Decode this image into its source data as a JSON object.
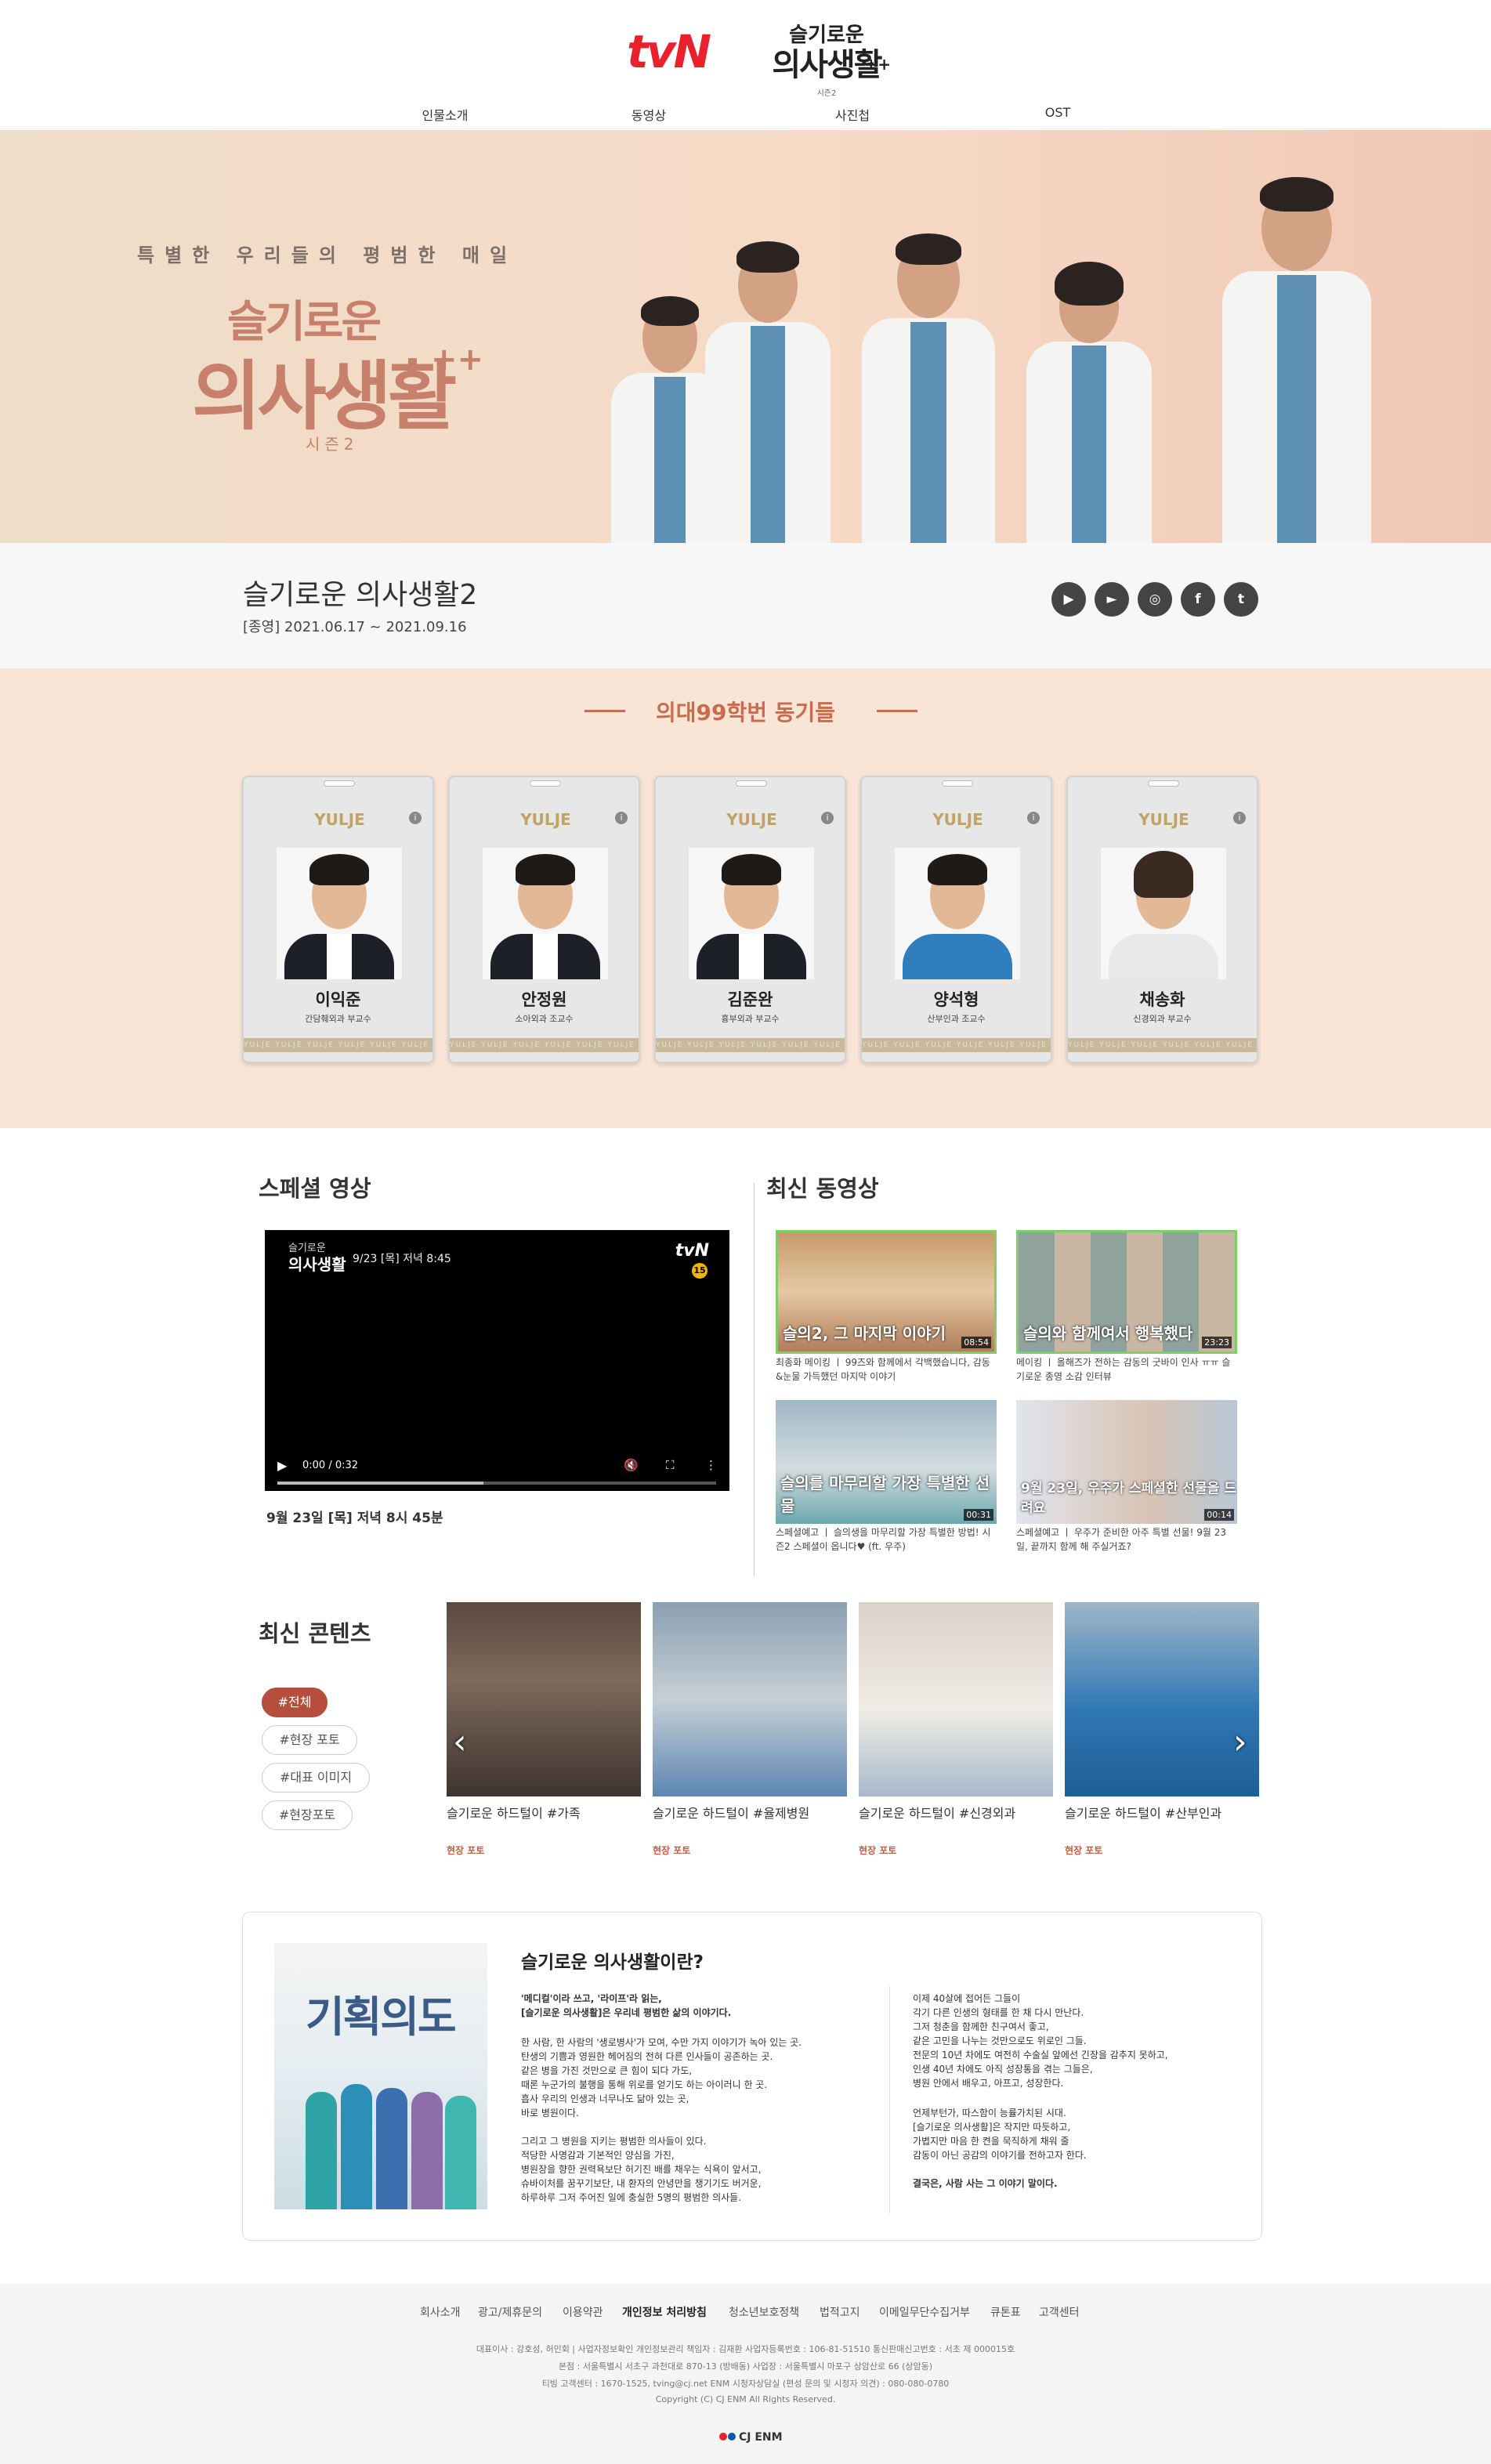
{
  "header": {
    "tvn_logo": "tvN",
    "show_logo_line1": "슬기로운",
    "show_logo_line2": "의사생활",
    "show_logo_plus": "++",
    "show_logo_season": "시즌2"
  },
  "nav": {
    "items": [
      "인물소개",
      "동영상",
      "사진첩",
      "OST"
    ]
  },
  "hero": {
    "tagline": "특별한 우리들의 평범한 매일",
    "title_line1": "슬기로운",
    "title_line2": "의사생활",
    "title_plus": "++",
    "season": "시즌2"
  },
  "info": {
    "title": "슬기로운 의사생활2",
    "date": "[종영] 2021.06.17 ~ 2021.09.16",
    "sns": [
      "tving-icon",
      "youtube-icon",
      "instagram-icon",
      "facebook-icon",
      "twitter-icon"
    ]
  },
  "cast": {
    "heading": "의대99학번 동기들",
    "hospital_logo": "YULJE",
    "band_text": "YULJE YULJE YULJE YULJE YULJE YULJE YULJE",
    "members": [
      {
        "name": "이익준",
        "role": "간담췌외과 부교수"
      },
      {
        "name": "안정원",
        "role": "소아외과 조교수"
      },
      {
        "name": "김준완",
        "role": "흉부외과 부교수"
      },
      {
        "name": "양석형",
        "role": "산부인과 조교수"
      },
      {
        "name": "채송화",
        "role": "신경외과 부교수"
      }
    ]
  },
  "special": {
    "heading": "스페셜 영상",
    "player_sub1": "슬기로운",
    "player_sub2": "의사생활",
    "player_sub3": "9/23 [목] 저녁 8:45",
    "player_channel": "tvN",
    "player_age": "15",
    "player_time": "0:00 / 0:32",
    "player_progress": 0.47,
    "air_text": "9월 23일 [목] 저녁 8시 45분"
  },
  "latest_videos": {
    "heading": "최신 동영상",
    "items": [
      {
        "overlay": "슬의2, 그 마지막 이야기",
        "duration": "08:54",
        "caption": "최종화 메이킹 ㅣ 99즈와 함께에서 각백했습니다, 감동&눈물 가득했던 마지막 이야기"
      },
      {
        "overlay": "슬의와 함께여서 행복했다",
        "duration": "23:23",
        "caption": "메이킹 ㅣ 올해즈가 전하는 감동의 굿바이 인사 ㅠㅠ 슬기로운 종영 소감 인터뷰"
      },
      {
        "overlay": "슬의를 마무리할 가장 특별한 선물",
        "duration": "00:31",
        "caption": "스페셜예고 ㅣ 슬의생을 마무리할 가장 특별한 방법! 시즌2 스페셜이 옵니다♥ (ft. 우주)"
      },
      {
        "overlay": "9월 23일, 우주가 스페셜한 선물을 드려요",
        "duration": "00:14",
        "caption": "스페셜예고 ㅣ 우주가 준비한 아주 특별 선물! 9월 23일, 끝까지 함께 해 주실거죠?"
      }
    ]
  },
  "contents": {
    "heading": "최신 콘텐츠",
    "filters": [
      "#전체",
      "#현장 포토",
      "#대표 이미지",
      "#현장포토"
    ],
    "active_filter": 0,
    "items": [
      {
        "title": "슬기로운 하드털이 #가족",
        "category": "현장 포토"
      },
      {
        "title": "슬기로운 하드털이 #율제병원",
        "category": "현장 포토"
      },
      {
        "title": "슬기로운 하드털이 #신경외과",
        "category": "현장 포토"
      },
      {
        "title": "슬기로운 하드털이 #산부인과",
        "category": "현장 포토"
      }
    ]
  },
  "about": {
    "poster_text": "기획의도",
    "heading": "슬기로운 의사생활이란?",
    "left_bold": "'메디컬'이라 쓰고, '라이프'라 읽는,\n[슬기로운 의사생활]은 우리네 평범한 삶의 이야기다.",
    "left_p1": "한 사람, 한 사람의 '생로병사'가 모여, 수만 가지 이야기가 녹아 있는 곳.\n탄생의 기쁨과 영원한 헤어짐의 전혀 다른 인사들이 공존하는 곳.\n같은 병을 가진 것만으로 큰 힘이 되다 가도,\n때론 누군가의 불행을 통해 위로를 얻기도 하는 아이러니 한 곳.\n흡사 우리의 인생과 너무나도 닮아 있는 곳,\n바로 병원이다.",
    "left_p2": "그리고 그 병원을 지키는 평범한 의사들이 있다.\n적당한 사명감과 기본적인 양심을 가진,\n병원장을 향한 권력욕보단 허기진 배를 채우는 식욕이 앞서고,\n슈바이처를 꿈꾸기보단, 내 환자의 안녕만을 챙기기도 버거운,\n하루하루 그저 주어진 일에 충실한 5명의 평범한 의사들.",
    "right_p1": "이제 40살에 접어든 그들이\n각기 다른 인생의 형태를 한 채 다시 만난다.\n그저 청춘을 함께한 친구여서 좋고,\n같은 고민을 나누는 것만으로도 위로인 그들.\n전문의 10년 차에도 여전히 수술실 앞에선 긴장을 감추지 못하고,\n인생 40년 차에도 아직 성장통을 겪는 그들은,\n병원 안에서 배우고, 아프고, 성장한다.",
    "right_p2": "언제부턴가, 따스함이 능률가치된 시대.\n[슬기로운 의사생활]은 작지만 따듯하고,\n가볍지만 마음 한 켠을 묵직하게 채워 줄\n감동이 아닌 공감의 이야기를 전하고자 한다.",
    "right_bold": "결국은, 사람 사는 그 이야기 말이다."
  },
  "footer": {
    "links": [
      "회사소개",
      "광고/제휴문의",
      "이용약관",
      "개인정보 처리방침",
      "청소년보호정책",
      "법적고지",
      "이메일무단수집거부",
      "큐톤표",
      "고객센터"
    ],
    "line1": "대표이사 : 강호성, 허민회 | 사업자정보확인    개인정보관리 책임자 : 김재환    사업자등록번호 : 106-81-51510    통신판매신고번호 : 서초 제 000015호",
    "line2": "본점 : 서울특별시 서초구 과천대로 870-13 (방배동)    사업장 : 서울특별시 마포구 상암산로 66 (상암동)",
    "line3": "티빙 고객센터 : 1670-1525, tving@cj.net    ENM 시청자상담실 (편성 문의 및 시청자 의견) : 080-080-0780",
    "copyright": "Copyright (C) CJ ENM All Rights Reserved.",
    "cj_logo": "CJ ENM"
  }
}
